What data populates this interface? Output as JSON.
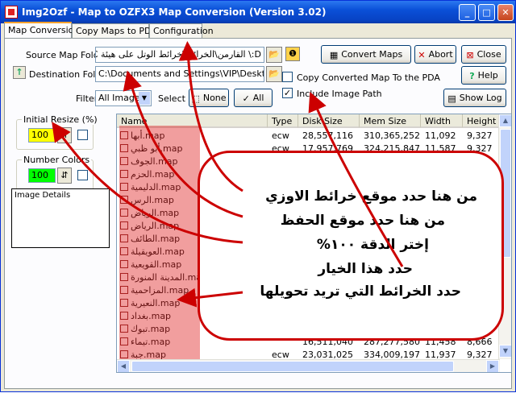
{
  "window": {
    "title": "Img2Ozf - Map to OZFX3 Map Conversion (Version 3.02)"
  },
  "tabs": [
    {
      "label": "Map Conversion"
    },
    {
      "label": "Copy Maps to PDA"
    },
    {
      "label": "Configuration"
    }
  ],
  "source": {
    "label": "Source Map Folder",
    "value": "D:\\ القارمن\\الخرائط\\خرائط الوتل على هيئة EC"
  },
  "destination": {
    "label": "Destination Folder",
    "value": "C:\\Documents and Settings\\VIP\\Desktop\\٢)"
  },
  "filter": {
    "label": "Filter",
    "value": "All Images",
    "select_label": "Select",
    "none_label": "None",
    "all_label": "All"
  },
  "buttons": {
    "convert": "Convert Maps",
    "abort": "Abort",
    "close": "Close",
    "help": "Help",
    "show_log": "Show Log"
  },
  "options": {
    "copy_to_pda": {
      "label": "Copy Converted Map To the PDA",
      "checked": false
    },
    "include_image_path": {
      "label": "Include Image Path",
      "checked": true
    }
  },
  "initial_resize": {
    "label": "Initial Resize (%)",
    "value": "100"
  },
  "number_colors": {
    "label": "Number Colors",
    "value": "100"
  },
  "image_details": {
    "label": "Image Details"
  },
  "list": {
    "columns": [
      "Name",
      "Type",
      "Disk Size",
      "Mem Size",
      "Width",
      "Height"
    ],
    "rows": [
      {
        "name": "أبها.map",
        "type": "ecw",
        "disk": "28,557,116",
        "mem": "310,365,252",
        "width": "11,092",
        "height": "9,327"
      },
      {
        "name": "أبو ظبي.map",
        "type": "ecw",
        "disk": "17,957,769",
        "mem": "324,215,847",
        "width": "11,587",
        "height": "9,327"
      },
      {
        "name": "الجوف.map",
        "type": "",
        "disk": "",
        "mem": "",
        "width": "",
        "height": "327"
      },
      {
        "name": "الحزم.map",
        "type": "",
        "disk": "",
        "mem": "",
        "width": "",
        "height": "327"
      },
      {
        "name": "الدليمية.map",
        "type": "",
        "disk": "",
        "mem": "",
        "width": "",
        "height": "66"
      },
      {
        "name": "الرس.map",
        "type": "",
        "disk": "",
        "mem": "",
        "width": "",
        "height": "66"
      },
      {
        "name": "الرياض.map",
        "type": "",
        "disk": "",
        "mem": "",
        "width": "",
        "height": "776"
      },
      {
        "name": "الرياض.map",
        "type": "",
        "disk": "",
        "mem": "",
        "width": "",
        "height": "27"
      },
      {
        "name": "الطائف.map",
        "type": "",
        "disk": "",
        "mem": "",
        "width": "",
        "height": "27"
      },
      {
        "name": "العويقيلة.map",
        "type": "",
        "disk": "",
        "mem": "",
        "width": "",
        "height": "27"
      },
      {
        "name": "القويعية.map",
        "type": "",
        "disk": "",
        "mem": "",
        "width": "",
        "height": "27"
      },
      {
        "name": "المدينة المنورة.map",
        "type": "",
        "disk": "",
        "mem": "",
        "width": "",
        "height": "27"
      },
      {
        "name": "المزاحمية.map",
        "type": "",
        "disk": "",
        "mem": "",
        "width": "",
        "height": "27"
      },
      {
        "name": "النعيرية.map",
        "type": "",
        "disk": "",
        "mem": "",
        "width": "",
        "height": "27"
      },
      {
        "name": "بغداد.map",
        "type": "",
        "disk": "",
        "mem": "",
        "width": "",
        "height": "27"
      },
      {
        "name": "تبوك.map",
        "type": "",
        "disk": "",
        "mem": "",
        "width": "",
        "height": "27"
      },
      {
        "name": "تيماء.map",
        "type": "",
        "disk": "16,511,040",
        "mem": "287,277,580",
        "width": "11,458",
        "height": "8,666"
      },
      {
        "name": "جبة.map",
        "type": "ecw",
        "disk": "23,031,025",
        "mem": "334,009,197",
        "width": "11,937",
        "height": "9,327"
      }
    ]
  },
  "callout": {
    "lines": [
      "من هنا حدد موقع خرائط الاوزي",
      "من هنا حدد موقع الحفظ",
      "إختر الدقة ١٠٠%",
      "حدد هذا الخيار",
      "حدد الخرائط التي تريد تحويلها"
    ]
  },
  "colors": {
    "highlight": "#e12828",
    "accent": "#0a50d8",
    "field_yellow": "#ffff00",
    "field_green": "#00ff00"
  }
}
